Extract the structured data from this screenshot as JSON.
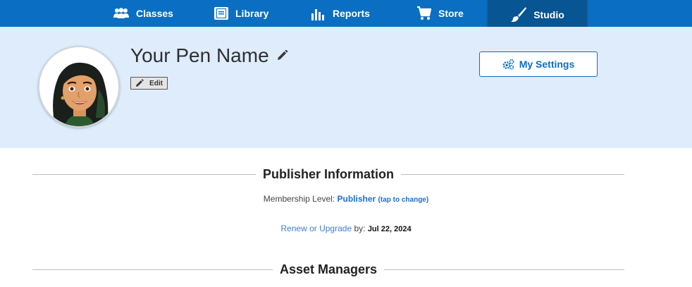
{
  "nav": {
    "items": [
      {
        "label": "Classes",
        "icon": "users-icon",
        "active": false
      },
      {
        "label": "Library",
        "icon": "book-icon",
        "active": false
      },
      {
        "label": "Reports",
        "icon": "bar-chart-icon",
        "active": false
      },
      {
        "label": "Store",
        "icon": "cart-icon",
        "active": false
      },
      {
        "label": "Studio",
        "icon": "paintbrush-icon",
        "active": true
      }
    ]
  },
  "profile": {
    "pen_name": "Your Pen Name",
    "edit_label": "Edit",
    "settings_label": "My Settings",
    "avatar_icon": "avatar-icon"
  },
  "publisher": {
    "heading": "Publisher Information",
    "membership_prefix": "Membership Level: ",
    "membership_level": "Publisher",
    "tap_to_change": "(tap to change)",
    "renew_link": "Renew or Upgrade",
    "renew_by": " by: ",
    "renew_date": "Jul 22, 2024"
  },
  "asset_managers": {
    "heading": "Asset Managers"
  },
  "colors": {
    "nav_bg": "#0a6fc2",
    "nav_active_bg": "#075592",
    "header_bg": "#deecfc",
    "link_blue": "#1a6fd1"
  }
}
